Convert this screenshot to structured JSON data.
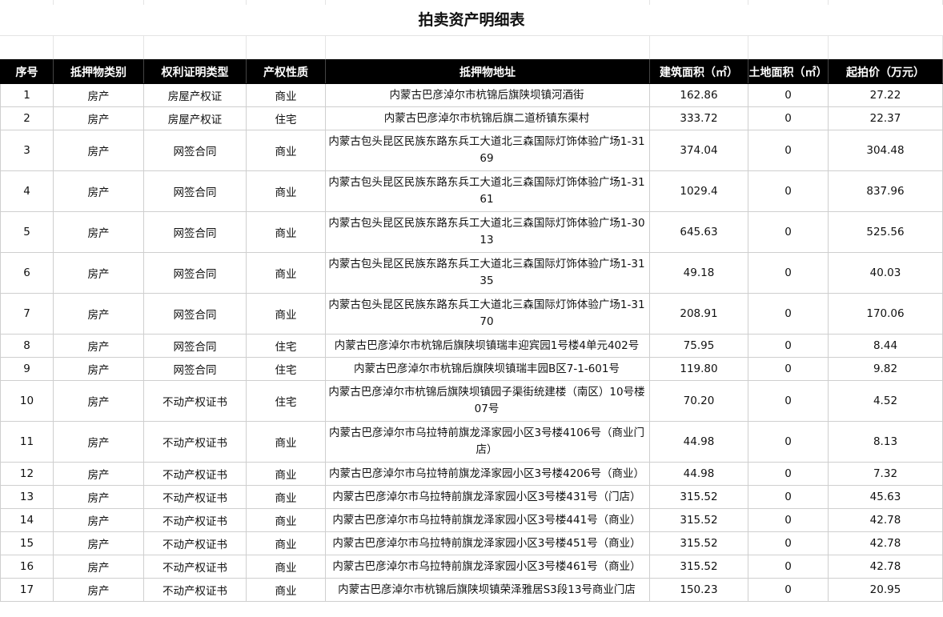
{
  "title": "拍卖资产明细表",
  "headers": [
    "序号",
    "抵押物类别",
    "权利证明类型",
    "产权性质",
    "抵押物地址",
    "建筑面积（㎡）",
    "土地面积（㎡）",
    "起拍价（万元）"
  ],
  "rows": [
    {
      "no": "1",
      "category": "房产",
      "cert": "房屋产权证",
      "nature": "商业",
      "address": "内蒙古巴彦淖尔市杭锦后旗陕坝镇河酒街",
      "building_area": "162.86",
      "land_area": "0",
      "price": "27.22"
    },
    {
      "no": "2",
      "category": "房产",
      "cert": "房屋产权证",
      "nature": "住宅",
      "address": "内蒙古巴彦淖尔市杭锦后旗二道桥镇东渠村",
      "building_area": "333.72",
      "land_area": "0",
      "price": "22.37"
    },
    {
      "no": "3",
      "category": "房产",
      "cert": "网签合同",
      "nature": "商业",
      "address": "内蒙古包头昆区民族东路东兵工大道北三森国际灯饰体验广场1-3169",
      "building_area": "374.04",
      "land_area": "0",
      "price": "304.48"
    },
    {
      "no": "4",
      "category": "房产",
      "cert": "网签合同",
      "nature": "商业",
      "address": "内蒙古包头昆区民族东路东兵工大道北三森国际灯饰体验广场1-3161",
      "building_area": "1029.4",
      "land_area": "0",
      "price": "837.96"
    },
    {
      "no": "5",
      "category": "房产",
      "cert": "网签合同",
      "nature": "商业",
      "address": "内蒙古包头昆区民族东路东兵工大道北三森国际灯饰体验广场1-3013",
      "building_area": "645.63",
      "land_area": "0",
      "price": "525.56"
    },
    {
      "no": "6",
      "category": "房产",
      "cert": "网签合同",
      "nature": "商业",
      "address": "内蒙古包头昆区民族东路东兵工大道北三森国际灯饰体验广场1-3135",
      "building_area": "49.18",
      "land_area": "0",
      "price": "40.03"
    },
    {
      "no": "7",
      "category": "房产",
      "cert": "网签合同",
      "nature": "商业",
      "address": "内蒙古包头昆区民族东路东兵工大道北三森国际灯饰体验广场1-3170",
      "building_area": "208.91",
      "land_area": "0",
      "price": "170.06"
    },
    {
      "no": "8",
      "category": "房产",
      "cert": "网签合同",
      "nature": "住宅",
      "address": "内蒙古巴彦淖尔市杭锦后旗陕坝镇瑞丰迎宾园1号楼4单元402号",
      "building_area": "75.95",
      "land_area": "0",
      "price": "8.44"
    },
    {
      "no": "9",
      "category": "房产",
      "cert": "网签合同",
      "nature": "住宅",
      "address": "内蒙古巴彦淖尔市杭锦后旗陕坝镇瑞丰园B区7-1-601号",
      "building_area": "119.80",
      "land_area": "0",
      "price": "9.82"
    },
    {
      "no": "10",
      "category": "房产",
      "cert": "不动产权证书",
      "nature": "住宅",
      "address": "内蒙古巴彦淖尔市杭锦后旗陕坝镇园子渠街统建楼（南区）10号楼07号",
      "building_area": "70.20",
      "land_area": "0",
      "price": "4.52"
    },
    {
      "no": "11",
      "category": "房产",
      "cert": "不动产权证书",
      "nature": "商业",
      "address": "内蒙古巴彦淖尔市乌拉特前旗龙泽家园小区3号楼4106号（商业门店）",
      "building_area": "44.98",
      "land_area": "0",
      "price": "8.13"
    },
    {
      "no": "12",
      "category": "房产",
      "cert": "不动产权证书",
      "nature": "商业",
      "address": "内蒙古巴彦淖尔市乌拉特前旗龙泽家园小区3号楼4206号（商业）",
      "building_area": "44.98",
      "land_area": "0",
      "price": "7.32"
    },
    {
      "no": "13",
      "category": "房产",
      "cert": "不动产权证书",
      "nature": "商业",
      "address": "内蒙古巴彦淖尔市乌拉特前旗龙泽家园小区3号楼431号（门店）",
      "building_area": "315.52",
      "land_area": "0",
      "price": "45.63"
    },
    {
      "no": "14",
      "category": "房产",
      "cert": "不动产权证书",
      "nature": "商业",
      "address": "内蒙古巴彦淖尔市乌拉特前旗龙泽家园小区3号楼441号（商业）",
      "building_area": "315.52",
      "land_area": "0",
      "price": "42.78"
    },
    {
      "no": "15",
      "category": "房产",
      "cert": "不动产权证书",
      "nature": "商业",
      "address": "内蒙古巴彦淖尔市乌拉特前旗龙泽家园小区3号楼451号（商业）",
      "building_area": "315.52",
      "land_area": "0",
      "price": "42.78"
    },
    {
      "no": "16",
      "category": "房产",
      "cert": "不动产权证书",
      "nature": "商业",
      "address": "内蒙古巴彦淖尔市乌拉特前旗龙泽家园小区3号楼461号（商业）",
      "building_area": "315.52",
      "land_area": "0",
      "price": "42.78"
    },
    {
      "no": "17",
      "category": "房产",
      "cert": "不动产权证书",
      "nature": "商业",
      "address": "内蒙古巴彦淖尔市杭锦后旗陕坝镇荣泽雅居S3段13号商业门店",
      "building_area": "150.23",
      "land_area": "0",
      "price": "20.95"
    }
  ]
}
